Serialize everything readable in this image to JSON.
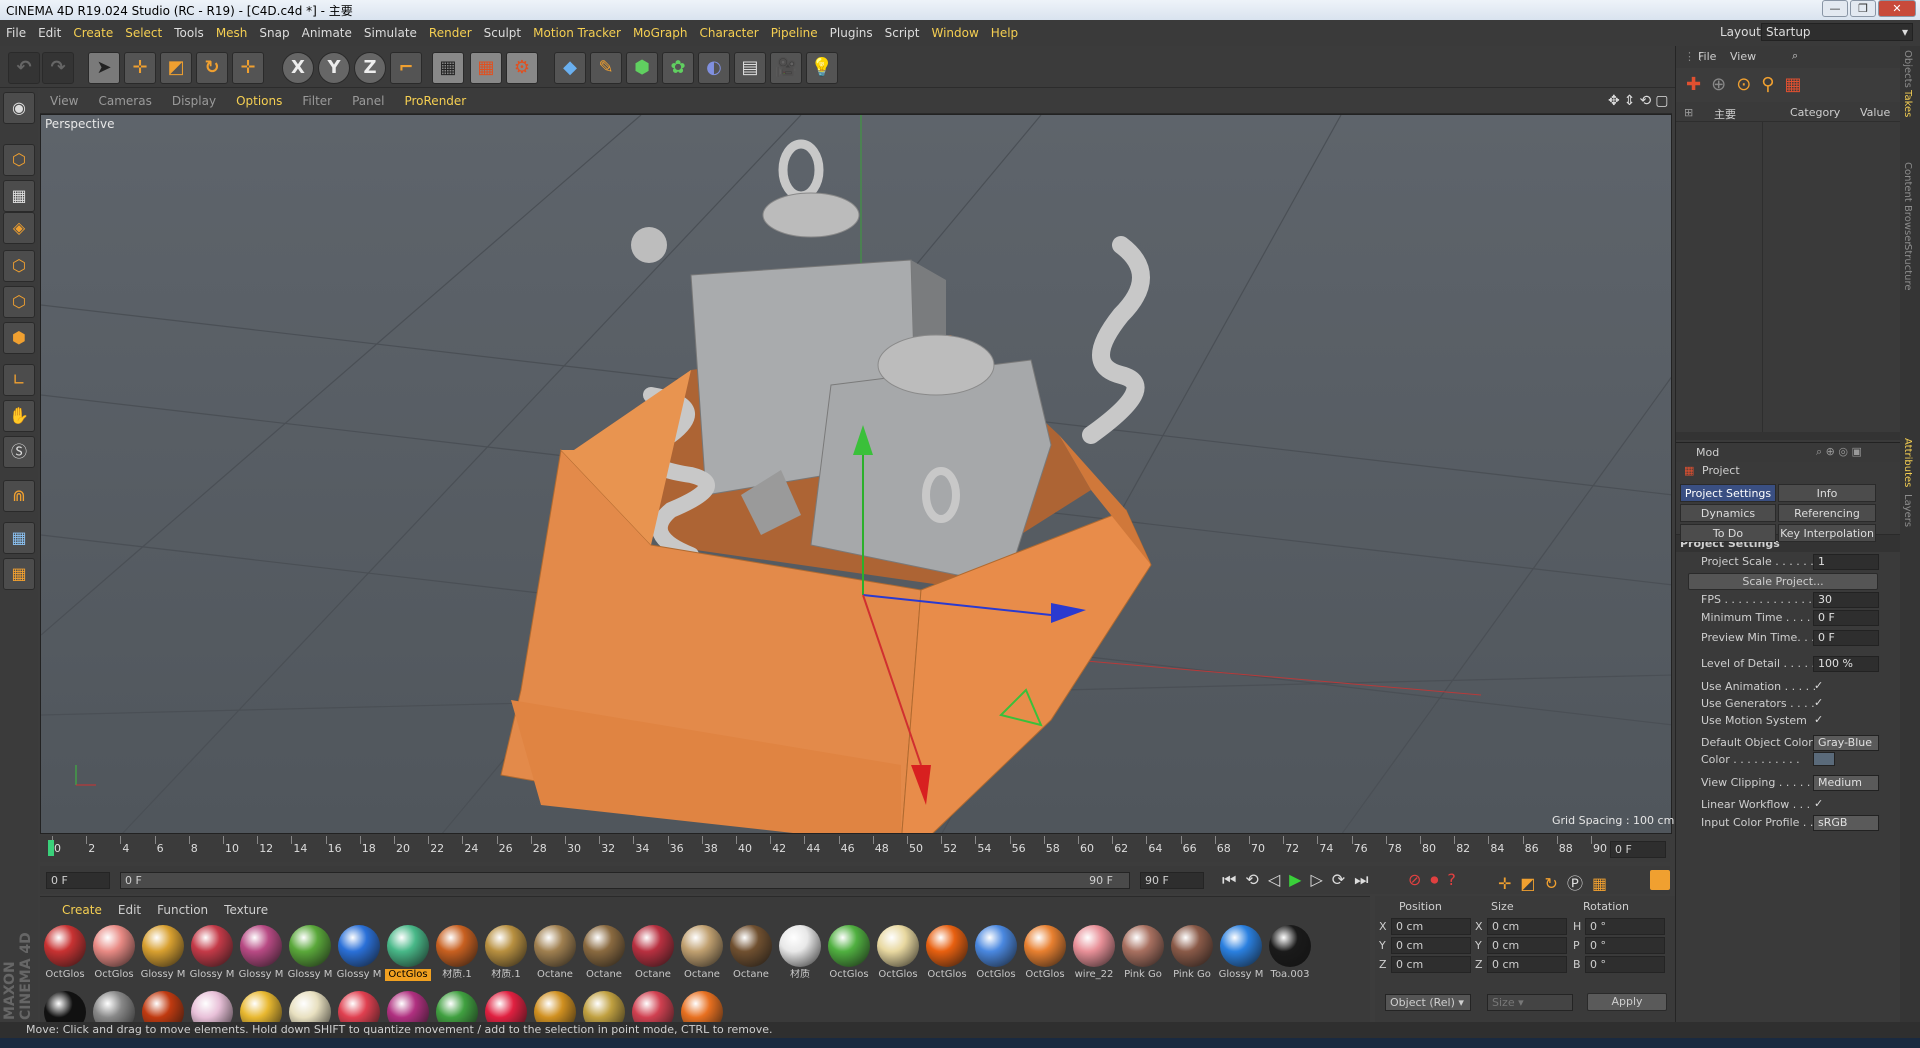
{
  "window": {
    "title": "CINEMA 4D R19.024 Studio (RC - R19) - [C4D.c4d *] - 主要"
  },
  "menu": [
    "File",
    "Edit",
    "Create",
    "Select",
    "Tools",
    "Mesh",
    "Snap",
    "Animate",
    "Simulate",
    "Render",
    "Sculpt",
    "Motion Tracker",
    "MoGraph",
    "Character",
    "Pipeline",
    "Plugins",
    "Script",
    "Window",
    "Help"
  ],
  "layout": {
    "label": "Layout:",
    "value": "Startup"
  },
  "viewport": {
    "menu": [
      "View",
      "Cameras",
      "Display",
      "Options",
      "Filter",
      "Panel",
      "ProRender"
    ],
    "label": "Perspective",
    "grid_spacing": "Grid Spacing : 100 cm"
  },
  "timeline": {
    "ticks": [
      "0",
      "2",
      "4",
      "6",
      "8",
      "10",
      "12",
      "14",
      "16",
      "18",
      "20",
      "22",
      "24",
      "26",
      "28",
      "30",
      "32",
      "34",
      "36",
      "38",
      "40",
      "42",
      "44",
      "46",
      "48",
      "50",
      "52",
      "54",
      "56",
      "58",
      "60",
      "62",
      "64",
      "66",
      "68",
      "70",
      "72",
      "74",
      "76",
      "78",
      "80",
      "82",
      "84",
      "86",
      "88",
      "90"
    ],
    "frame_field": "0 F",
    "start_field": "0 F",
    "range_start": "0 F",
    "range_end": "90 F",
    "end_field": "90 F"
  },
  "materials": {
    "tabs": [
      "Create",
      "Edit",
      "Function",
      "Texture"
    ],
    "row1": [
      {
        "label": "OctGlos",
        "color": "#c83232"
      },
      {
        "label": "OctGlos",
        "color": "#e88a84"
      },
      {
        "label": "Glossy M",
        "color": "#d8a030"
      },
      {
        "label": "Glossy M",
        "color": "#c43a48"
      },
      {
        "label": "Glossy M",
        "color": "#b84a84"
      },
      {
        "label": "Glossy M",
        "color": "#5aa83a"
      },
      {
        "label": "Glossy M",
        "color": "#2a70d8"
      },
      {
        "label": "OctGlos",
        "color": "#48b888"
      },
      {
        "label": "材质.1",
        "color": "#c86020"
      },
      {
        "label": "材质.1",
        "color": "#b89040"
      },
      {
        "label": "Octane",
        "color": "#a08050"
      },
      {
        "label": "Octane",
        "color": "#8a6a40"
      },
      {
        "label": "Octane",
        "color": "#b83040"
      },
      {
        "label": "Octane",
        "color": "#c0a070"
      },
      {
        "label": "Octane",
        "color": "#705030"
      },
      {
        "label": "材质",
        "color": "#e8e8e8"
      },
      {
        "label": "OctGlos",
        "color": "#50b040"
      },
      {
        "label": "OctGlos",
        "color": "#e8d8a0"
      },
      {
        "label": "OctGlos",
        "color": "#e86010"
      },
      {
        "label": "OctGlos",
        "color": "#4a88e0"
      },
      {
        "label": "OctGlos",
        "color": "#e88030"
      },
      {
        "label": "wire_22",
        "color": "#e89098"
      },
      {
        "label": "Pink Go",
        "color": "#a87060"
      },
      {
        "label": "Pink Go",
        "color": "#8a5a48"
      },
      {
        "label": "Glossy M",
        "color": "#2a80e0"
      },
      {
        "label": "Toa.003",
        "color": "#1a1a1a"
      }
    ],
    "row2": [
      "#111111",
      "#888888",
      "#c03a10",
      "#e8c0d8",
      "#e8b830",
      "#e8e0c0",
      "#e04050",
      "#b03080",
      "#40a040",
      "#e02040",
      "#d09020",
      "#c0a040",
      "#d04050",
      "#e87020"
    ],
    "selected_index": 7
  },
  "coords": {
    "headers": [
      "Position",
      "Size",
      "Rotation"
    ],
    "rows": [
      {
        "axis": "X",
        "pos": "0 cm",
        "saxis": "X",
        "size": "0 cm",
        "raxis": "H",
        "rot": "0 °"
      },
      {
        "axis": "Y",
        "pos": "0 cm",
        "saxis": "Y",
        "size": "0 cm",
        "raxis": "P",
        "rot": "0 °"
      },
      {
        "axis": "Z",
        "pos": "0 cm",
        "saxis": "Z",
        "size": "0 cm",
        "raxis": "B",
        "rot": "0 °"
      }
    ],
    "mode": "Object (Rel)",
    "size_mode": "Size",
    "apply": "Apply"
  },
  "objects": {
    "menu": [
      "File",
      "View"
    ],
    "tree_item": "主要",
    "col_category": "Category",
    "col_value": "Value"
  },
  "attributes": {
    "menu": "Mod",
    "title": "Project",
    "tabs": [
      "Project Settings",
      "Info",
      "Dynamics",
      "Referencing",
      "To Do",
      "Key Interpolation"
    ],
    "section": "Project Settings",
    "fields": [
      {
        "label": "Project Scale . . . . . .",
        "value": "1"
      },
      {
        "label": "FPS . . . . . . . . . . . . .",
        "value": "30"
      },
      {
        "label": "Minimum Time . . . . .",
        "value": "0 F"
      },
      {
        "label": "Preview Min Time. . .",
        "value": "0 F"
      },
      {
        "label": "Level of Detail . . . . .",
        "value": "100 %"
      }
    ],
    "scale_btn": "Scale Project...",
    "checks": [
      {
        "label": "Use Animation . . . . .",
        "value": "✓"
      },
      {
        "label": "Use Generators . . . .",
        "value": "✓"
      },
      {
        "label": "Use Motion System",
        "value": "✓"
      }
    ],
    "default_color_label": "Default Object Color",
    "default_color": "Gray-Blue",
    "color_label": "Color . . . . . . . . . .",
    "clipping_label": "View Clipping . . . . .",
    "clipping": "Medium",
    "workflow_label": "Linear Workflow . . .",
    "workflow": "✓",
    "profile_label": "Input Color Profile . .",
    "profile": "sRGB"
  },
  "sidetabs": [
    "Objects",
    "Takes",
    "Content Browser",
    "Structure",
    "Attributes",
    "Layers"
  ],
  "status": "Move: Click and drag to move elements. Hold down SHIFT to quantize movement / add to the selection in point mode, CTRL to remove.",
  "brand": "MAXON CINEMA 4D"
}
